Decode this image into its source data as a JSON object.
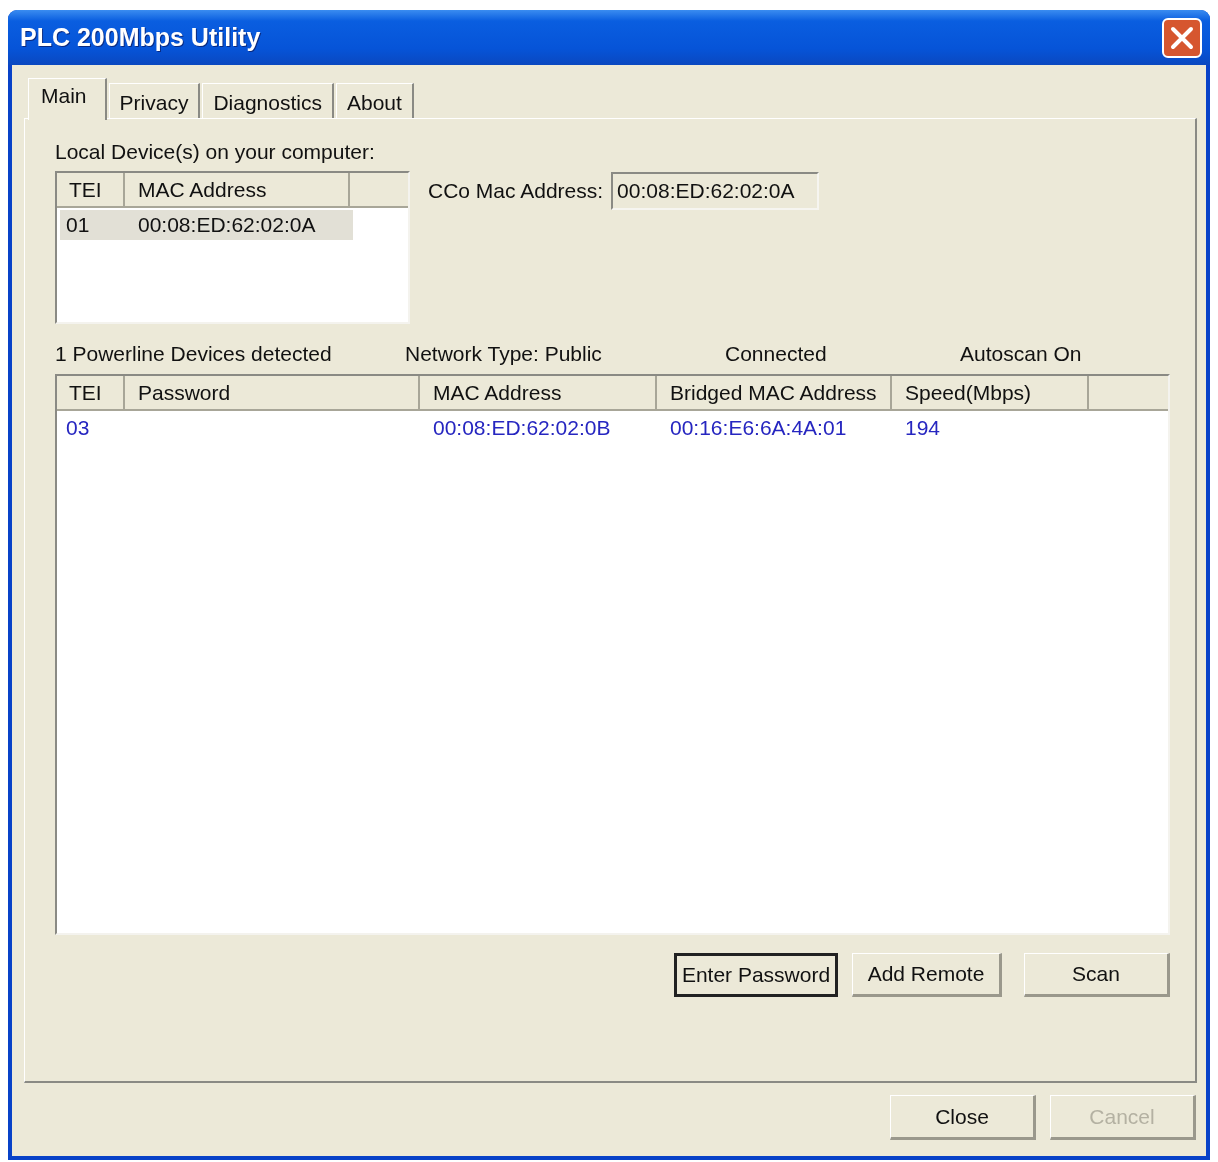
{
  "window": {
    "title": "PLC 200Mbps Utility"
  },
  "tabs": [
    {
      "label": "Main",
      "selected": true
    },
    {
      "label": "Privacy",
      "selected": false
    },
    {
      "label": "Diagnostics",
      "selected": false
    },
    {
      "label": "About",
      "selected": false
    }
  ],
  "local_devices": {
    "label": "Local Device(s) on your computer:",
    "columns": [
      "TEI",
      "MAC Address"
    ],
    "rows": [
      {
        "tei": "01",
        "mac_address": "00:08:ED:62:02:0A",
        "selected": true
      }
    ]
  },
  "cco_mac": {
    "label": "CCo Mac Address:",
    "value": "00:08:ED:62:02:0A"
  },
  "status": {
    "detected": "1 Powerline Devices detected",
    "network_type": "Network Type: Public",
    "connection": "Connected",
    "autoscan": "Autoscan On"
  },
  "remote_devices": {
    "columns": [
      "TEI",
      "Password",
      "MAC Address",
      "Bridged MAC Address",
      "Speed(Mbps)"
    ],
    "rows": [
      {
        "tei": "03",
        "mac_address": "00:08:ED:62:02:0B",
        "bridged_mac_address": "00:16:E6:6A:4A:01",
        "speed": "194",
        "selected": false
      }
    ]
  },
  "panel_buttons": [
    {
      "label": "Enter Password",
      "default": true,
      "disabled": false
    },
    {
      "label": "Add Remote",
      "default": false,
      "disabled": false
    },
    {
      "label": "Scan",
      "default": false,
      "disabled": false
    }
  ],
  "dialog_buttons": [
    {
      "label": "Close",
      "disabled": false
    },
    {
      "label": "Cancel",
      "disabled": true
    }
  ]
}
